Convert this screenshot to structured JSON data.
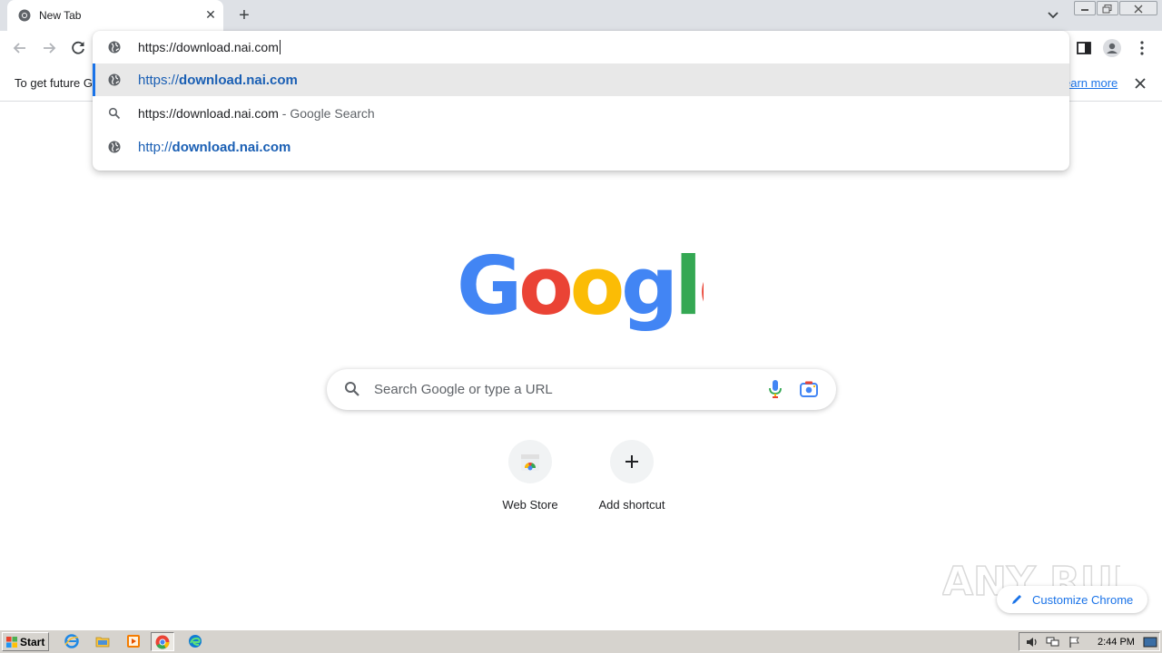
{
  "tab": {
    "title": "New Tab",
    "close_icon": "close-icon"
  },
  "omnibox": {
    "typed_text": "https://download.nai.com",
    "suggestions": [
      {
        "icon": "globe-icon",
        "prefix": "https://",
        "bold": "download.nai.com",
        "suffix": "",
        "selected": true
      },
      {
        "icon": "search-icon",
        "text": "https://download.nai.com",
        "suffix": " - Google Search",
        "selected": false
      },
      {
        "icon": "globe-icon",
        "prefix": "http://",
        "bold": "download.nai.com",
        "suffix": "",
        "selected": false
      }
    ]
  },
  "infobar": {
    "text": "To get future G",
    "link": "earn more"
  },
  "ntp": {
    "logo_text": "Google",
    "search_placeholder": "Search Google or type a URL",
    "shortcuts": [
      {
        "label": "Web Store",
        "icon": "web-store-icon"
      },
      {
        "label": "Add shortcut",
        "icon": "plus-icon"
      }
    ],
    "customize_label": "Customize Chrome"
  },
  "watermark": {
    "text": "ANY RUN"
  },
  "taskbar": {
    "start_label": "Start",
    "clock": "2:44 PM"
  },
  "colors": {
    "accent": "#1a73e8",
    "tabstrip": "#dee1e6",
    "taskbar": "#d6d3ce",
    "url_blue": "#1a5fb4"
  }
}
